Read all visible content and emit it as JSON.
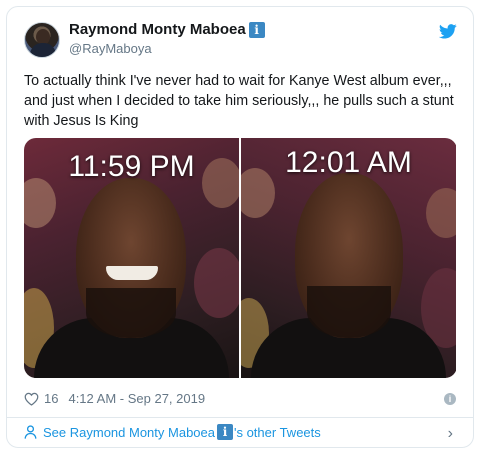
{
  "tweet": {
    "author_name": "Raymond Monty Maboea",
    "badge_glyph": "i",
    "handle": "@RayMaboya",
    "text": "To actually think I've never had to wait for Kanye West album ever,,, and just when I decided to take him seriously,,, he pulls such a stunt with Jesus Is King",
    "media": {
      "left_caption": "11:59 PM",
      "right_caption": "12:01 AM"
    },
    "likes": "16",
    "timestamp": "4:12 AM - Sep 27, 2019",
    "info_glyph": "i"
  },
  "footer": {
    "prefix": "See Raymond Monty Maboea",
    "suffix": "'s other Tweets",
    "chevron": "›"
  },
  "icons": {
    "bird": "twitter-bird-icon",
    "heart": "heart-icon",
    "info": "info-icon",
    "person": "person-icon",
    "chevron": "chevron-right-icon"
  },
  "colors": {
    "link": "#1b95e0",
    "badge": "#3b88c3",
    "muted": "#657786",
    "twitter_blue": "#1da1f2"
  }
}
